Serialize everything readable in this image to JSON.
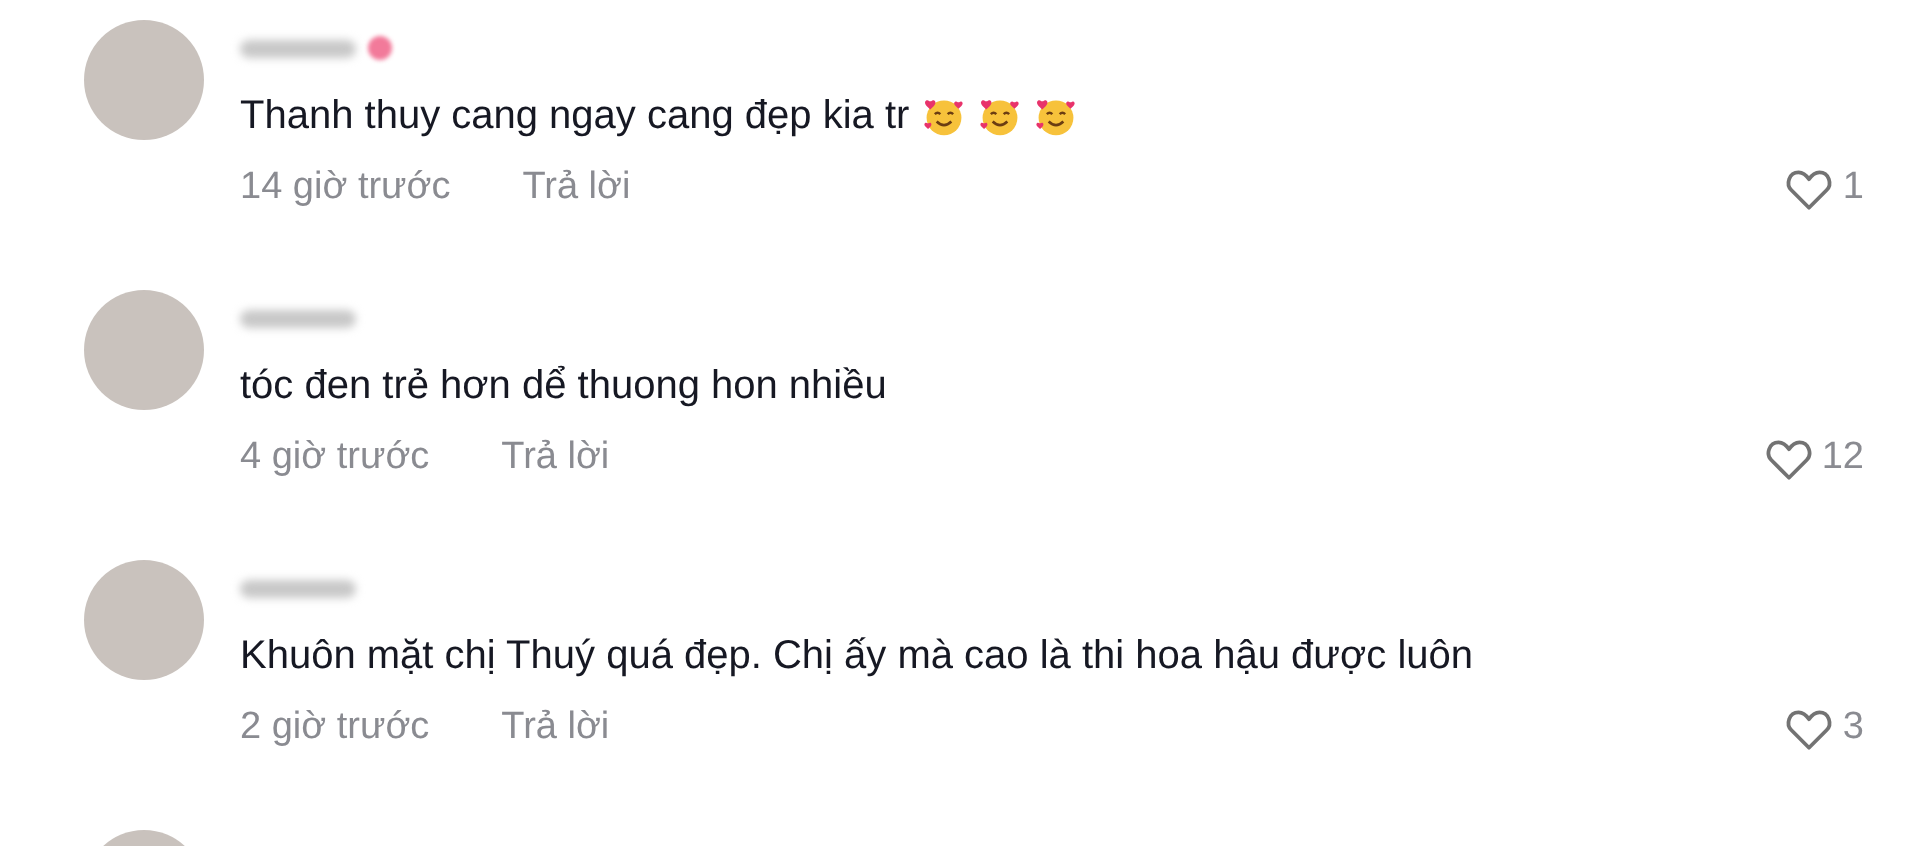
{
  "comments": [
    {
      "badge": true,
      "text": "Thanh thuy cang ngay cang đẹp kia tr",
      "emojis": [
        {
          "kind": "smiling-face-with-hearts"
        },
        {
          "kind": "smiling-face-with-hearts"
        },
        {
          "kind": "smiling-face-with-hearts"
        }
      ],
      "time": "14 giờ trước",
      "reply": "Trả lời",
      "likes": "1"
    },
    {
      "badge": false,
      "text": "tóc đen trẻ hơn dể thuong hon nhiều",
      "time": "4 giờ trước",
      "reply": "Trả lời",
      "likes": "12"
    },
    {
      "badge": false,
      "text": "Khuôn mặt chị Thuý quá đẹp. Chị ấy mà cao là thi hoa hậu được luôn",
      "time": "2 giờ trước",
      "reply": "Trả lời",
      "likes": "3"
    }
  ],
  "more_below": true
}
